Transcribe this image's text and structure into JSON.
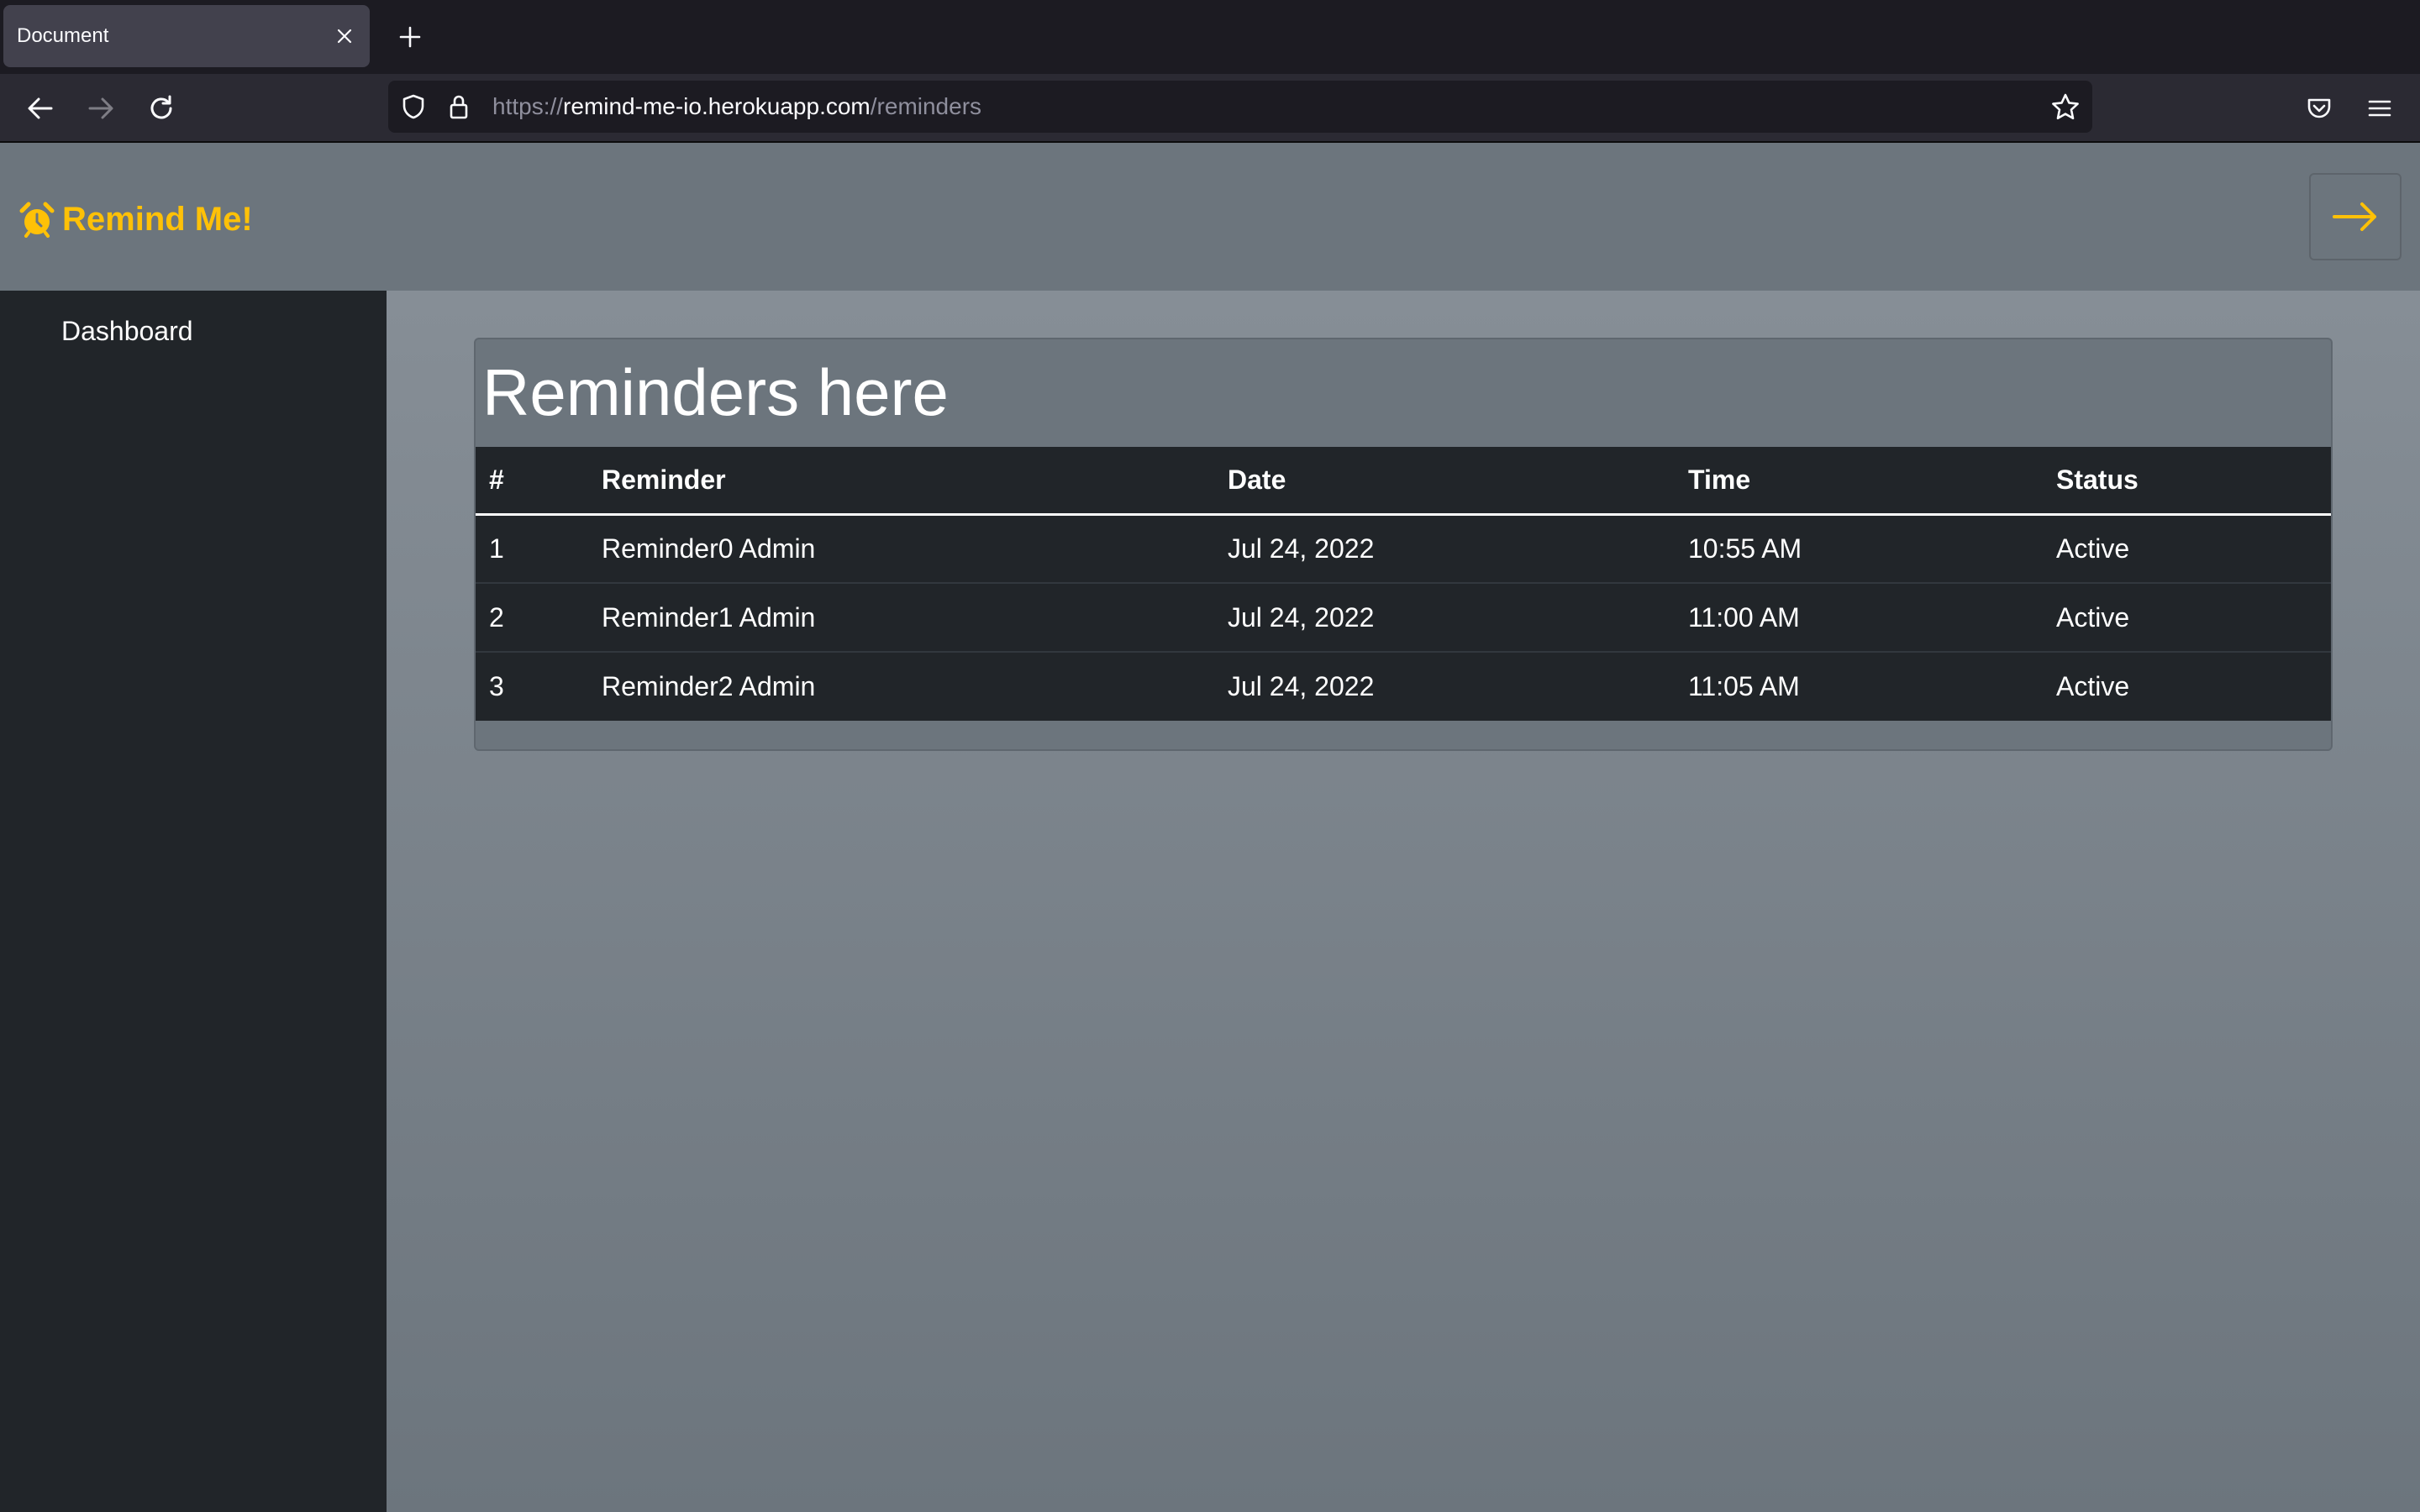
{
  "browser": {
    "tab_title": "Document",
    "url_scheme": "https://",
    "url_host": "remind-me-io.herokuapp.com",
    "url_path": "/reminders"
  },
  "header": {
    "brand": "Remind Me!",
    "brand_color": "#ffc107"
  },
  "sidebar": {
    "items": [
      {
        "label": "Dashboard"
      }
    ]
  },
  "main": {
    "title": "Reminders here",
    "columns": [
      "#",
      "Reminder",
      "Date",
      "Time",
      "Status"
    ],
    "rows": [
      [
        "1",
        "Reminder0 Admin",
        "Jul 24, 2022",
        "10:55 AM",
        "Active"
      ],
      [
        "2",
        "Reminder1 Admin",
        "Jul 24, 2022",
        "11:00 AM",
        "Active"
      ],
      [
        "3",
        "Reminder2 Admin",
        "Jul 24, 2022",
        "11:05 AM",
        "Active"
      ]
    ]
  }
}
